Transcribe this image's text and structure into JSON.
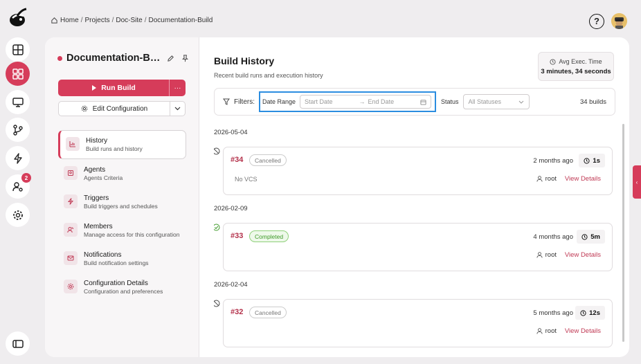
{
  "breadcrumb": {
    "home": "Home",
    "items": [
      "Projects",
      "Doc-Site",
      "Documentation-Build"
    ]
  },
  "rail": {
    "items": [
      {
        "icon": "layout-icon",
        "active": false
      },
      {
        "icon": "dashboard-grid-icon",
        "active": true
      },
      {
        "icon": "monitor-icon",
        "active": false
      },
      {
        "icon": "git-branch-icon",
        "active": false
      },
      {
        "icon": "lightning-icon",
        "active": false
      },
      {
        "icon": "user-settings-icon",
        "active": false,
        "badge": "2"
      },
      {
        "icon": "gear-icon",
        "active": false
      }
    ],
    "bottom_icon": "sidebar-toggle-icon"
  },
  "project": {
    "title": "Documentation-Bu...",
    "run_label": "Run Build",
    "more_label": "···",
    "edit_label": "Edit Configuration"
  },
  "nav": [
    {
      "title": "History",
      "subtitle": "Build runs and history",
      "icon": "chart-icon",
      "active": true
    },
    {
      "title": "Agents",
      "subtitle": "Agents Criteria",
      "icon": "agent-icon",
      "active": false
    },
    {
      "title": "Triggers",
      "subtitle": "Build triggers and schedules",
      "icon": "lightning-icon",
      "active": false
    },
    {
      "title": "Members",
      "subtitle": "Manage access for this configuration",
      "icon": "members-icon",
      "active": false
    },
    {
      "title": "Notifications",
      "subtitle": "Build notification settings",
      "icon": "mail-icon",
      "active": false
    },
    {
      "title": "Configuration Details",
      "subtitle": "Configuration and preferences",
      "icon": "gear-icon",
      "active": false
    }
  ],
  "history": {
    "title": "Build History",
    "subtitle": "Recent build runs and execution history",
    "avg_label": "Avg Exec. Time",
    "avg_value": "3 minutes, 34 seconds",
    "filters_label": "Filters:",
    "date_range_label": "Date Range",
    "start_placeholder": "Start Date",
    "range_arrow": "→",
    "end_placeholder": "End Date",
    "status_label": "Status",
    "status_value": "All Statuses",
    "builds_count": "34 builds",
    "groups": [
      {
        "date": "2026-05-04",
        "builds": [
          {
            "number": "#34",
            "status": "Cancelled",
            "status_type": "cancelled",
            "vcs": "No VCS",
            "ago": "2 months ago",
            "duration": "1s",
            "user": "root",
            "view": "View Details"
          }
        ]
      },
      {
        "date": "2026-02-09",
        "builds": [
          {
            "number": "#33",
            "status": "Completed",
            "status_type": "completed",
            "vcs": "",
            "ago": "4 months ago",
            "duration": "5m",
            "user": "root",
            "view": "View Details"
          }
        ]
      },
      {
        "date": "2026-02-04",
        "builds": [
          {
            "number": "#32",
            "status": "Cancelled",
            "status_type": "cancelled",
            "vcs": "",
            "ago": "5 months ago",
            "duration": "12s",
            "user": "root",
            "view": "View Details"
          }
        ]
      }
    ]
  },
  "colors": {
    "accent": "#d63c5a",
    "link": "#c03a55",
    "highlight": "#2b8de0"
  }
}
